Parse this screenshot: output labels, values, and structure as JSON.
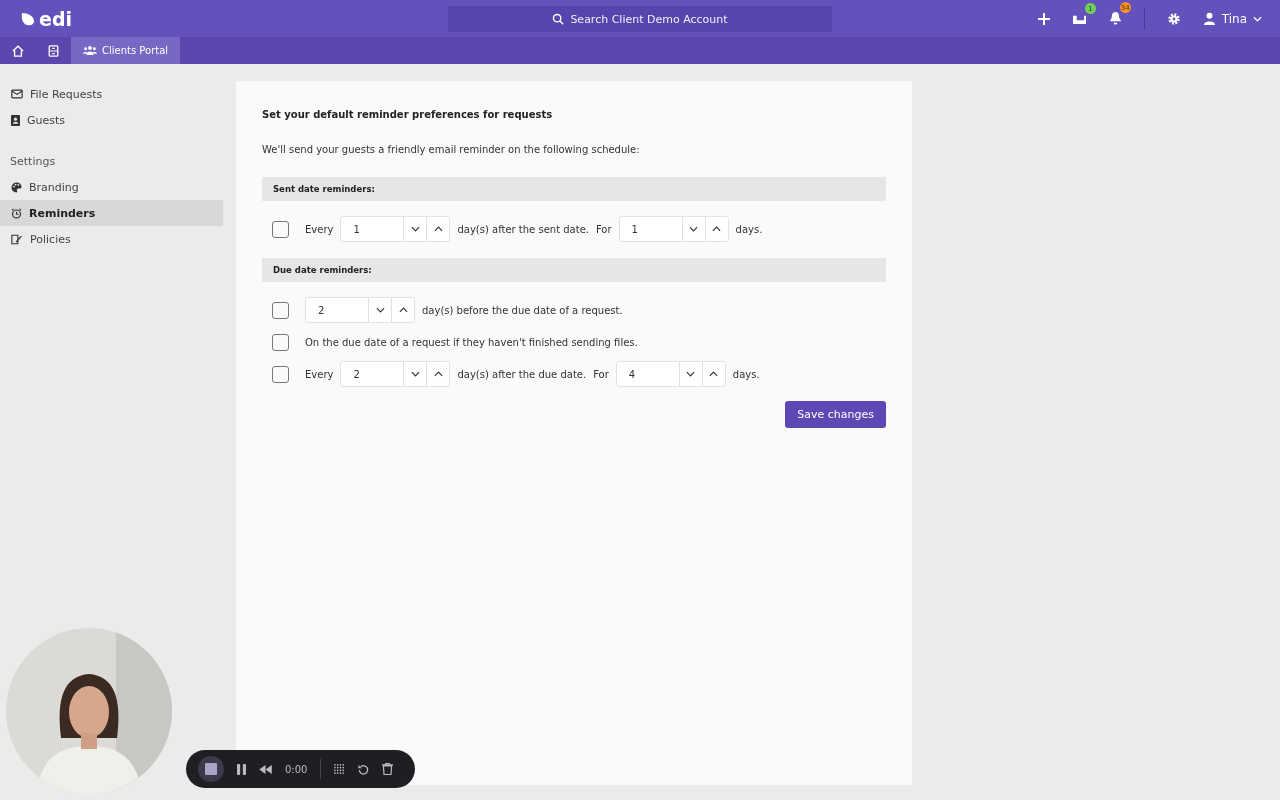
{
  "header": {
    "logo": "edi",
    "search_placeholder": "Search Client Demo Account",
    "inbox_badge": "1",
    "notifications_badge": "34",
    "user": "Tina"
  },
  "tabs": [
    {
      "kind": "home",
      "selected": false
    },
    {
      "kind": "cabinet",
      "selected": false
    },
    {
      "kind": "clients",
      "label": "Clients Portal",
      "selected": true
    }
  ],
  "sidebar": {
    "items": [
      {
        "kind": "mail",
        "label": "File Requests",
        "selected": false
      },
      {
        "kind": "contact",
        "label": "Guests",
        "selected": false
      }
    ],
    "section": "Settings",
    "settings_items": [
      {
        "kind": "palette",
        "label": "Branding",
        "selected": false
      },
      {
        "kind": "alarm",
        "label": "Reminders",
        "selected": true
      },
      {
        "kind": "policy",
        "label": "Policies",
        "selected": false
      }
    ]
  },
  "content": {
    "title": "Set your default reminder preferences for requests",
    "intro": "We'll send your guests a friendly email reminder on the following schedule:",
    "sections": [
      {
        "heading": "Sent date reminders:",
        "rows": [
          {
            "checked": false,
            "parts": [
              {
                "kind": "text",
                "text": "Every"
              },
              {
                "kind": "number",
                "value": "1"
              },
              {
                "kind": "text",
                "text": "day(s) after the sent date."
              },
              {
                "kind": "text",
                "text": "For"
              },
              {
                "kind": "number",
                "value": "1"
              },
              {
                "kind": "text",
                "text": "days."
              }
            ]
          }
        ]
      },
      {
        "heading": "Due date reminders:",
        "rows": [
          {
            "checked": false,
            "parts": [
              {
                "kind": "number",
                "value": "2"
              },
              {
                "kind": "text",
                "text": "day(s) before the due date of a request."
              }
            ]
          },
          {
            "checked": false,
            "parts": [
              {
                "kind": "text",
                "text": "On the due date of a request if they haven't finished sending files."
              }
            ]
          },
          {
            "checked": false,
            "parts": [
              {
                "kind": "text",
                "text": "Every"
              },
              {
                "kind": "number",
                "value": "2"
              },
              {
                "kind": "text",
                "text": "day(s) after the due date."
              },
              {
                "kind": "text",
                "text": "For"
              },
              {
                "kind": "number",
                "value": "4"
              },
              {
                "kind": "text",
                "text": "days."
              }
            ]
          }
        ]
      }
    ],
    "save_button": "Save changes"
  },
  "recorder": {
    "time": "0:00"
  }
}
